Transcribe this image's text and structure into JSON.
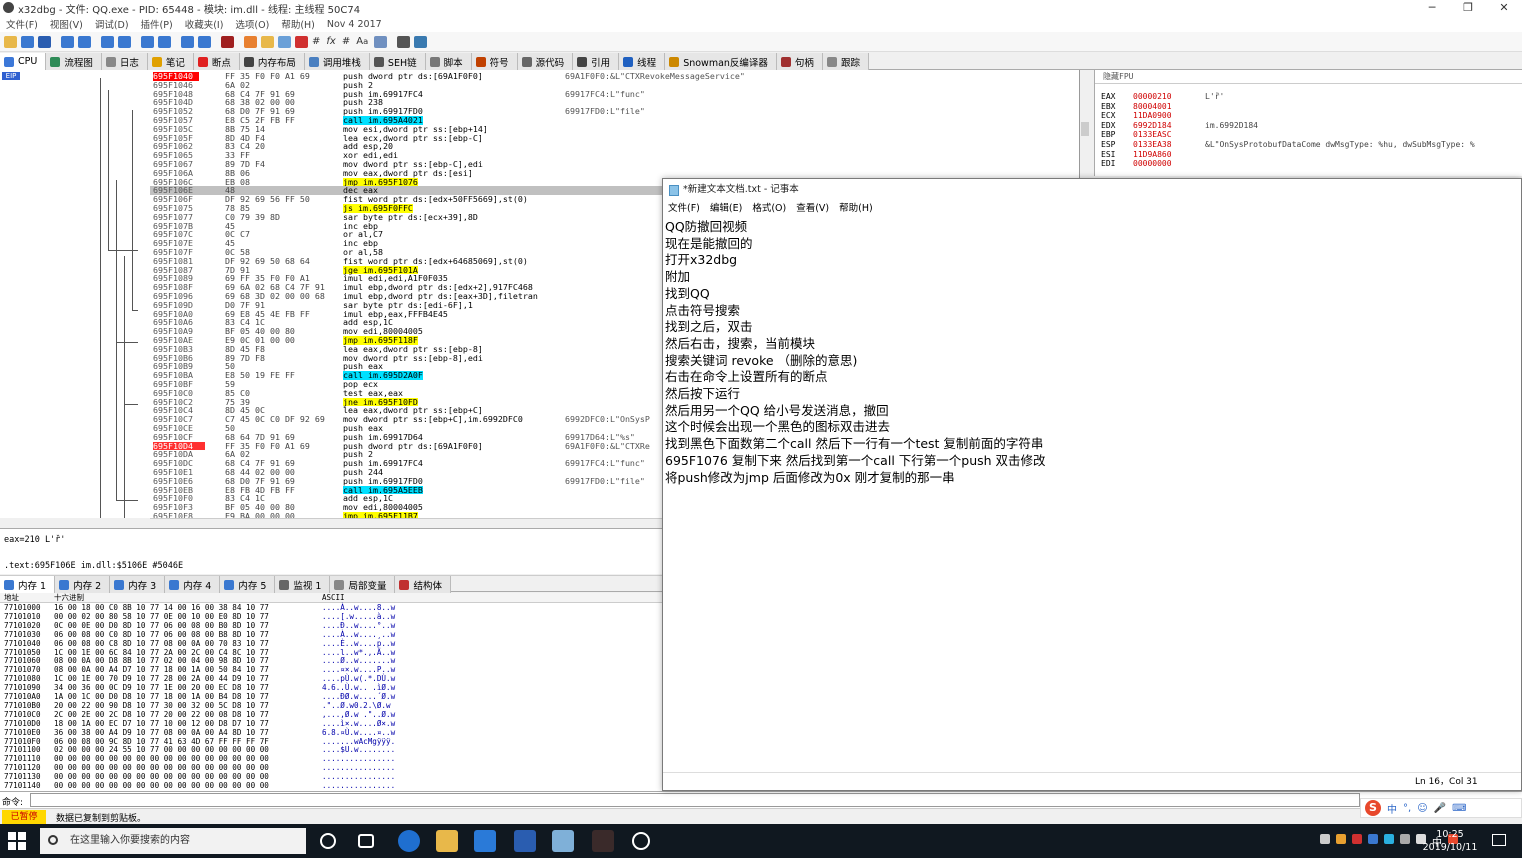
{
  "window": {
    "title": "x32dbg - 文件: QQ.exe - PID: 65448 - 模块: im.dll - 线程: 主线程 50C74"
  },
  "menu": [
    "文件(F)",
    "视图(V)",
    "调试(D)",
    "插件(P)",
    "收藏夹(I)",
    "选项(O)",
    "帮助(H)",
    "Nov 4 2017"
  ],
  "tabs": [
    "CPU",
    "流程图",
    "日志",
    "笔记",
    "断点",
    "内存布局",
    "调用堆栈",
    "SEH链",
    "脚本",
    "符号",
    "源代码",
    "引用",
    "线程",
    "Snowman反编译器",
    "句柄",
    "跟踪"
  ],
  "tab_colors": [
    "#3c78d8",
    "#2e8b57",
    "#888",
    "#e0a000",
    "#e02020",
    "#444",
    "#4a7fc0",
    "#555",
    "#777",
    "#c04000",
    "#666",
    "#444",
    "#2060c0",
    "#cc8800",
    "#a03030",
    "#888"
  ],
  "eip_label": "EIP",
  "disasm": [
    {
      "addr": "695F1040",
      "bytes": "FF 35 F0 F0 A1 69",
      "ins": "push dword ptr ds:[69A1F0F0]",
      "com": "69A1F0F0:&L\"CTXRevokeMessageService\"",
      "rip": true
    },
    {
      "addr": "695F1046",
      "bytes": "6A 02",
      "ins": "push 2",
      "com": ""
    },
    {
      "addr": "695F1048",
      "bytes": "68 C4 7F 91 69",
      "ins": "push im.69917FC4",
      "com": "69917FC4:L\"func\""
    },
    {
      "addr": "695F104D",
      "bytes": "68 38 02 00 00",
      "ins": "push 238",
      "com": ""
    },
    {
      "addr": "695F1052",
      "bytes": "68 D0 7F 91 69",
      "ins": "push im.69917FD0",
      "com": "69917FD0:L\"file\""
    },
    {
      "addr": "695F1057",
      "bytes": "E8 C5 2F FB FF",
      "ins": "call im.695A4021",
      "com": "",
      "call": true
    },
    {
      "addr": "695F105C",
      "bytes": "8B 75 14",
      "ins": "mov esi,dword ptr ss:[ebp+14]",
      "com": ""
    },
    {
      "addr": "695F105F",
      "bytes": "8D 4D F4",
      "ins": "lea ecx,dword ptr ss:[ebp-C]",
      "com": ""
    },
    {
      "addr": "695F1062",
      "bytes": "83 C4 20",
      "ins": "add esp,20",
      "com": ""
    },
    {
      "addr": "695F1065",
      "bytes": "33 FF",
      "ins": "xor edi,edi",
      "com": ""
    },
    {
      "addr": "695F1067",
      "bytes": "89 7D F4",
      "ins": "mov dword ptr ss:[ebp-C],edi",
      "com": ""
    },
    {
      "addr": "695F106A",
      "bytes": "8B 06",
      "ins": "mov eax,dword ptr ds:[esi]",
      "com": ""
    },
    {
      "addr": "695F106C",
      "bytes": "EB 08",
      "ins": "jmp im.695F1076",
      "com": "",
      "jmp": true
    },
    {
      "addr": "695F106E",
      "bytes": "48",
      "ins": "dec eax",
      "com": "",
      "sel": true
    },
    {
      "addr": "695F106F",
      "bytes": "DF 92 69 56 FF 50",
      "ins": "fist word ptr ds:[edx+50FF5669],st(0)",
      "com": ""
    },
    {
      "addr": "695F1075",
      "bytes": "78 85",
      "ins": "js im.695F0FFC",
      "com": "",
      "jmp": true
    },
    {
      "addr": "695F1077",
      "bytes": "C0 79 39 8D",
      "ins": "sar byte ptr ds:[ecx+39],8D",
      "com": ""
    },
    {
      "addr": "695F107B",
      "bytes": "45",
      "ins": "inc ebp",
      "com": ""
    },
    {
      "addr": "695F107C",
      "bytes": "0C C7",
      "ins": "or al,C7",
      "com": ""
    },
    {
      "addr": "695F107E",
      "bytes": "45",
      "ins": "inc ebp",
      "com": ""
    },
    {
      "addr": "695F107F",
      "bytes": "0C 58",
      "ins": "or al,58",
      "com": ""
    },
    {
      "addr": "695F1081",
      "bytes": "DF 92 69 50 68 64",
      "ins": "fist word ptr ds:[edx+64685069],st(0)",
      "com": ""
    },
    {
      "addr": "695F1087",
      "bytes": "7D 91",
      "ins": "jge im.695F101A",
      "com": "",
      "jmp": true
    },
    {
      "addr": "695F1089",
      "bytes": "69 FF 35 F0 F0 A1",
      "ins": "imul edi,edi,A1F0F035",
      "com": ""
    },
    {
      "addr": "695F108F",
      "bytes": "69 6A 02 68 C4 7F 91",
      "ins": "imul ebp,dword ptr ds:[edx+2],917FC468",
      "com": ""
    },
    {
      "addr": "695F1096",
      "bytes": "69 68 3D 02 00 00 68",
      "ins": "imul ebp,dword ptr ds:[eax+3D],filetran",
      "com": ""
    },
    {
      "addr": "695F109D",
      "bytes": "D0 7F 91",
      "ins": "sar byte ptr ds:[edi-6F],1",
      "com": ""
    },
    {
      "addr": "695F10A0",
      "bytes": "69 E8 45 4E FB FF",
      "ins": "imul ebp,eax,FFFB4E45",
      "com": ""
    },
    {
      "addr": "695F10A6",
      "bytes": "83 C4 1C",
      "ins": "add esp,1C",
      "com": ""
    },
    {
      "addr": "695F10A9",
      "bytes": "BF 05 40 00 80",
      "ins": "mov edi,80004005",
      "com": ""
    },
    {
      "addr": "695F10AE",
      "bytes": "E9 0C 01 00 00",
      "ins": "jmp im.695F118F",
      "com": "",
      "jmp": true
    },
    {
      "addr": "695F10B3",
      "bytes": "8D 45 F8",
      "ins": "lea eax,dword ptr ss:[ebp-8]",
      "com": ""
    },
    {
      "addr": "695F10B6",
      "bytes": "89 7D F8",
      "ins": "mov dword ptr ss:[ebp-8],edi",
      "com": ""
    },
    {
      "addr": "695F10B9",
      "bytes": "50",
      "ins": "push eax",
      "com": ""
    },
    {
      "addr": "695F10BA",
      "bytes": "E8 50 19 FE FF",
      "ins": "call im.695D2A0F",
      "com": "",
      "call": true
    },
    {
      "addr": "695F10BF",
      "bytes": "59",
      "ins": "pop ecx",
      "com": ""
    },
    {
      "addr": "695F10C0",
      "bytes": "85 C0",
      "ins": "test eax,eax",
      "com": ""
    },
    {
      "addr": "695F10C2",
      "bytes": "75 39",
      "ins": "jne im.695F10FD",
      "com": "",
      "jmp": true
    },
    {
      "addr": "695F10C4",
      "bytes": "8D 45 0C",
      "ins": "lea eax,dword ptr ss:[ebp+C]",
      "com": ""
    },
    {
      "addr": "695F10C7",
      "bytes": "C7 45 0C C0 DF 92 69",
      "ins": "mov dword ptr ss:[ebp+C],im.6992DFC0",
      "com": "6992DFC0:L\"OnSysP"
    },
    {
      "addr": "695F10CE",
      "bytes": "50",
      "ins": "push eax",
      "com": ""
    },
    {
      "addr": "695F10CF",
      "bytes": "68 64 7D 91 69",
      "ins": "push im.69917D64",
      "com": "69917D64:L\"%s\""
    },
    {
      "addr": "695F10D4",
      "bytes": "FF 35 F0 F0 A1 69",
      "ins": "push dword ptr ds:[69A1F0F0]",
      "com": "69A1F0F0:&L\"CTXRe",
      "bp": true
    },
    {
      "addr": "695F10DA",
      "bytes": "6A 02",
      "ins": "push 2",
      "com": ""
    },
    {
      "addr": "695F10DC",
      "bytes": "68 C4 7F 91 69",
      "ins": "push im.69917FC4",
      "com": "69917FC4:L\"func\""
    },
    {
      "addr": "695F10E1",
      "bytes": "68 44 02 00 00",
      "ins": "push 244",
      "com": ""
    },
    {
      "addr": "695F10E6",
      "bytes": "68 D0 7F 91 69",
      "ins": "push im.69917FD0",
      "com": "69917FD0:L\"file\""
    },
    {
      "addr": "695F10EB",
      "bytes": "E8 FB 4D FB FF",
      "ins": "call im.695A5EEB",
      "com": "",
      "call": true
    },
    {
      "addr": "695F10F0",
      "bytes": "83 C4 1C",
      "ins": "add esp,1C",
      "com": ""
    },
    {
      "addr": "695F10F3",
      "bytes": "BF 05 40 00 80",
      "ins": "mov edi,80004005",
      "com": ""
    },
    {
      "addr": "695F10F8",
      "bytes": "E9 BA 00 00 00",
      "ins": "jmp im.695F11B7",
      "com": "",
      "jmp": true
    }
  ],
  "fpu": {
    "header": "隐藏FPU",
    "regs": [
      {
        "n": "EAX",
        "v": "00000210",
        "x": "L'ȑ'"
      },
      {
        "n": "EBX",
        "v": "80004001",
        "x": ""
      },
      {
        "n": "ECX",
        "v": "11DA0900",
        "x": ""
      },
      {
        "n": "EDX",
        "v": "6992D184",
        "x": "im.6992D184"
      },
      {
        "n": "EBP",
        "v": "0133EASC",
        "x": ""
      },
      {
        "n": "ESP",
        "v": "0133EA38",
        "x": "&L\"OnSysProtobufDataCome dwMsgType: %hu, dwSubMsgType: %"
      },
      {
        "n": "ESI",
        "v": "11D9A860",
        "x": ""
      },
      {
        "n": "EDI",
        "v": "00000000",
        "x": ""
      }
    ]
  },
  "info": {
    "line1": "eax=210 L'ȑ'",
    "line2": ".text:695F106E im.dll:$5106E #5046E"
  },
  "dump_tabs": [
    "内存 1",
    "内存 2",
    "内存 3",
    "内存 4",
    "内存 5",
    "监视 1",
    "局部变量",
    "结构体"
  ],
  "dump_header": {
    "addr": "地址",
    "hex": "十六进制",
    "ascii": "ASCII"
  },
  "dump": [
    {
      "a": "77101000",
      "h": "16 00 18 00 C0 8B 10 77 14 00 16 00 38 84 10 77",
      "s": "....À..w....8..w"
    },
    {
      "a": "77101010",
      "h": "00 00 02 00 80 58 10 77 0E 00 10 00 E0 8D 10 77",
      "s": "....[.w.....à..w"
    },
    {
      "a": "77101020",
      "h": "0C 00 0E 00 D0 8D 10 77 06 00 08 00 B0 8D 10 77",
      "s": "....Ð..w....°..w"
    },
    {
      "a": "77101030",
      "h": "06 00 08 00 C0 8D 10 77 06 00 08 00 B8 8D 10 77",
      "s": "....À..w....¸..w"
    },
    {
      "a": "77101040",
      "h": "06 00 08 00 C8 8D 10 77 08 00 0A 00 70 83 10 77",
      "s": "....È..w....p..w"
    },
    {
      "a": "77101050",
      "h": "1C 00 1E 00 6C 84 10 77 2A 00 2C 00 C4 8C 10 77",
      "s": "....l..w*.,.Ä..w"
    },
    {
      "a": "77101060",
      "h": "08 00 0A 00 D8 8B 10 77 02 00 04 00 98 8D 10 77",
      "s": "....Ø..w.......w"
    },
    {
      "a": "77101070",
      "h": "08 00 0A 00 A4 D7 10 77 18 00 1A 00 50 84 10 77",
      "s": "....¤×.w....P..w"
    },
    {
      "a": "77101080",
      "h": "1C 00 1E 00 70 D9 10 77 28 00 2A 00 44 D9 10 77",
      "s": "....pÙ.w(.*.DÙ.w"
    },
    {
      "a": "77101090",
      "h": "34 00 36 00 0C D9 10 77 1E 00 20 00 EC D8 10 77",
      "s": "4.6..Ù.w.. .ìØ.w"
    },
    {
      "a": "771010A0",
      "h": "1A 00 1C 00 D0 D8 10 77 18 00 1A 00 B4 D8 10 77",
      "s": "....ÐØ.w....´Ø.w"
    },
    {
      "a": "771010B0",
      "h": "20 00 22 00 90 D8 10 77 30 00 32 00 5C D8 10 77",
      "s": " .\"..Ø.w0.2.\\Ø.w"
    },
    {
      "a": "771010C0",
      "h": "2C 00 2E 00 2C D8 10 77 20 00 22 00 08 D8 10 77",
      "s": ",...,Ø.w .\"..Ø.w"
    },
    {
      "a": "771010D0",
      "h": "18 00 1A 00 EC D7 10 77 10 00 12 00 D8 D7 10 77",
      "s": "....ì×.w....Ø×.w"
    },
    {
      "a": "771010E0",
      "h": "36 00 38 00 A4 D9 10 77 08 00 0A 00 A4 8D 10 77",
      "s": "6.8.¤Ù.w....¤..w"
    },
    {
      "a": "771010F0",
      "h": "06 00 08 00 9C 8D 10 77 41 63 4D 67 FF FF FF 7F",
      "s": ".......wAcMgÿÿÿ."
    },
    {
      "a": "77101100",
      "h": "02 00 00 00 24 55 10 77 00 00 00 00 00 00 00 00",
      "s": "....$U.w........"
    },
    {
      "a": "77101110",
      "h": "00 00 00 00 00 00 00 00 00 00 00 00 00 00 00 00",
      "s": "................"
    },
    {
      "a": "77101120",
      "h": "00 00 00 00 00 00 00 00 00 00 00 00 00 00 00 00",
      "s": "................"
    },
    {
      "a": "77101130",
      "h": "00 00 00 00 00 00 00 00 00 00 00 00 00 00 00 00",
      "s": "................"
    },
    {
      "a": "77101140",
      "h": "00 00 00 00 00 00 00 00 00 00 00 00 00 00 00 00",
      "s": "................"
    }
  ],
  "command": {
    "label": "命令:"
  },
  "status": {
    "paused": "已暂停",
    "message": "数据已复制到剪贴板。"
  },
  "notepad": {
    "title": "*新建文本文档.txt - 记事本",
    "menu": [
      "文件(F)",
      "编辑(E)",
      "格式(O)",
      "查看(V)",
      "帮助(H)"
    ],
    "lines": [
      "QQ防撤回视频",
      "现在是能撤回的",
      "打开x32dbg",
      "附加",
      "找到QQ",
      "点击符号搜索",
      "找到之后，双击",
      " 然后右击，搜索，当前模块",
      "搜索关键词 revoke （删除的意思)",
      "右击在命令上设置所有的断点",
      "然后按下运行",
      "然后用另一个QQ 给小号发送消息，撤回",
      "这个时候会出现一个黑色的图标双击进去",
      "找到黑色下面数第二个call  然后下一行有一个test 复制前面的字符串",
      "695F1076 复制下来 然后找到第一个call  下行第一个push 双击修改",
      "将push修改为jmp  后面修改为0x 刚才复制的那一串"
    ],
    "status": "Ln 16，Col 31"
  },
  "ime": {
    "items": [
      "中",
      "°,",
      "☺",
      "🎤",
      "⌨"
    ]
  },
  "taskbar": {
    "search_placeholder": "在这里输入你要搜索的内容",
    "time": "10:25",
    "date": "2019/10/11",
    "lang": "中"
  }
}
